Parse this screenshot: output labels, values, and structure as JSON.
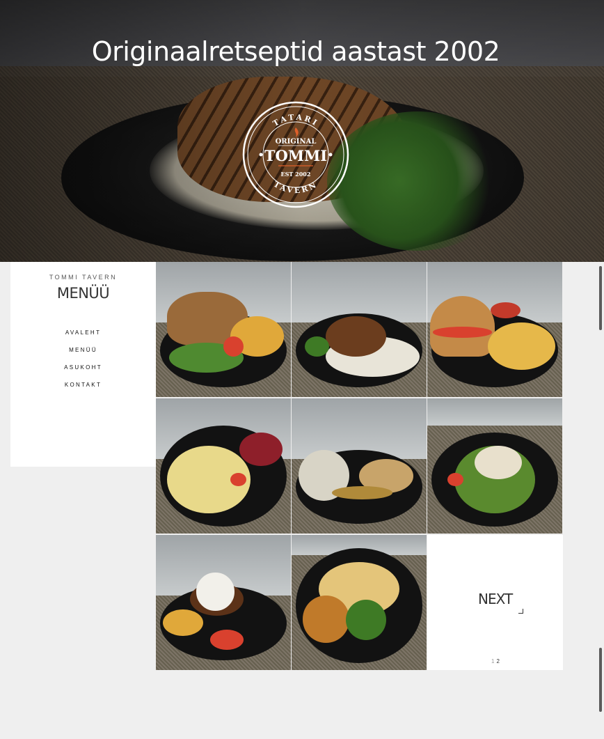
{
  "hero": {
    "title": "Originaalretseptid aastast 2002"
  },
  "logo": {
    "top_text": "TATARI",
    "line1": "ORIGINAL",
    "name": "TOMMI",
    "est": "EST 2002",
    "bottom_text": "TAVERN"
  },
  "sidebar": {
    "brand": "TOMMI TAVERN",
    "title": "MENÜÜ",
    "nav": [
      "AVALEHT",
      "MENÜÜ",
      "ASUKOHT",
      "KONTAKT"
    ]
  },
  "gallery": {
    "next_label": "NEXT",
    "pages": [
      "1",
      "2"
    ]
  },
  "colors": {
    "background": "#efefef",
    "panel": "#ffffff",
    "text": "#333333"
  }
}
